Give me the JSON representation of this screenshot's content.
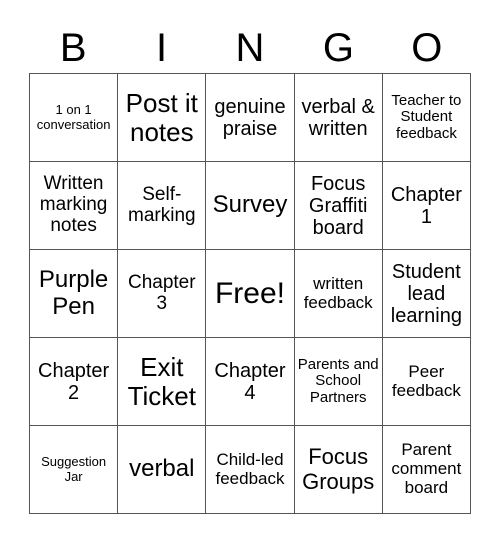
{
  "header": {
    "letters": [
      "B",
      "I",
      "N",
      "G",
      "O"
    ]
  },
  "cells": [
    [
      "1 on 1 conversation",
      "Post it notes",
      "genuine praise",
      "verbal & written",
      "Teacher to Student feedback"
    ],
    [
      "Written marking notes",
      "Self-marking",
      "Survey",
      "Focus Graffiti board",
      "Chapter 1"
    ],
    [
      "Purple Pen",
      "Chapter 3",
      "Free!",
      "written feedback",
      "Student lead learning"
    ],
    [
      "Chapter 2",
      "Exit Ticket",
      "Chapter 4",
      "Parents and School Partners",
      "Peer feedback"
    ],
    [
      "Suggestion Jar",
      "verbal",
      "Child-led feedback",
      "Focus Groups",
      "Parent comment board"
    ]
  ]
}
